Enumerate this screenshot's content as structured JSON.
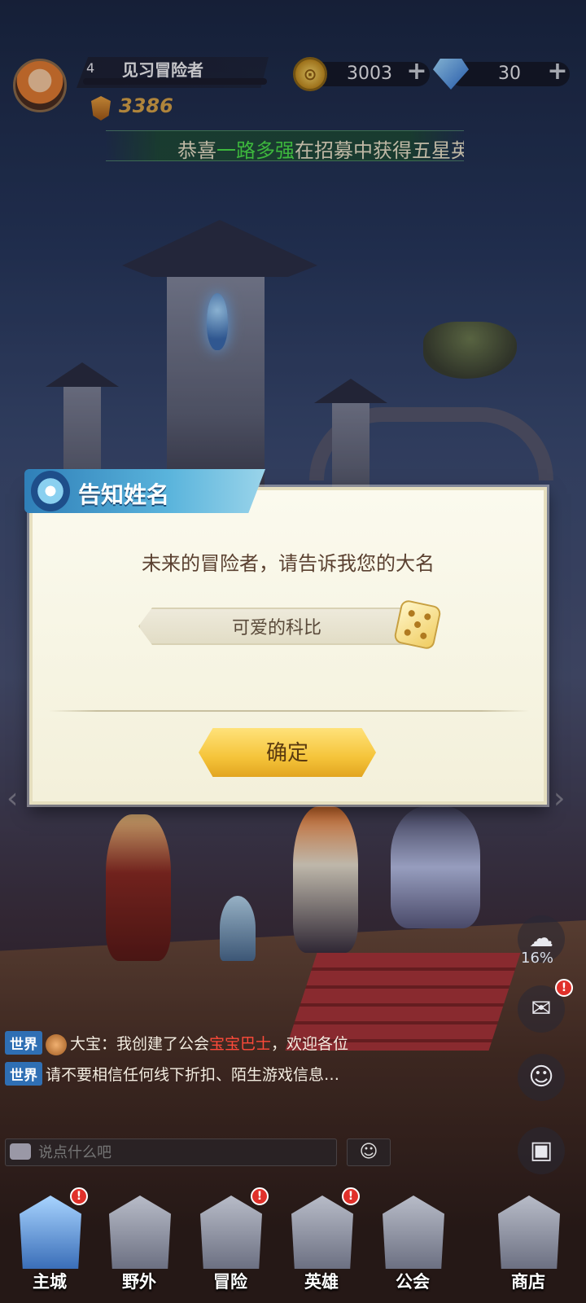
{
  "player": {
    "level": "4",
    "title": "见习冒险者",
    "power": "3386"
  },
  "resources": {
    "gold": "3003",
    "gems": "30"
  },
  "ticker": {
    "prefix": "恭喜",
    "player_name": "一路多强",
    "suffix": "在招募中获得五星英"
  },
  "dialog": {
    "title": "告知姓名",
    "prompt": "未来的冒险者，请告诉我您的大名",
    "name_value": "可爱的科比",
    "confirm_label": "确定"
  },
  "chat": {
    "messages": [
      {
        "channel": "世界",
        "sender": "大宝：",
        "text_before": "我创建了公会",
        "highlight": "宝宝巴士",
        "text_after": "，欢迎各位"
      },
      {
        "channel": "世界",
        "text": "请不要相信任何线下折扣、陌生游戏信息…"
      }
    ],
    "placeholder": "说点什么吧"
  },
  "side": {
    "download_percent": "16%"
  },
  "nav": {
    "items": [
      {
        "label": "主城",
        "badge": "!"
      },
      {
        "label": "野外"
      },
      {
        "label": "冒险",
        "badge": "!"
      },
      {
        "label": "英雄",
        "badge": "!"
      },
      {
        "label": "公会"
      },
      {
        "label": "商店"
      }
    ]
  },
  "colors": {
    "accent_blue": "#2f7fb8",
    "confirm_yellow": "#f5c43a",
    "gold_text": "#d6a248",
    "ticker_highlight": "#4be04b",
    "chat_highlight": "#ff4a3a"
  }
}
